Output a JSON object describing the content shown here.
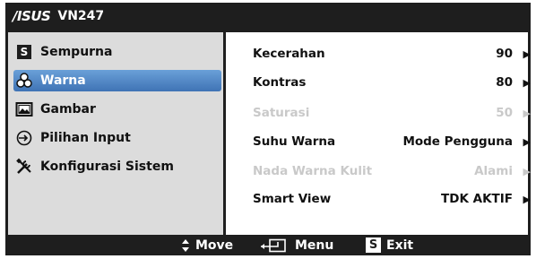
{
  "header": {
    "brand": "/ISUS",
    "model": "VN247"
  },
  "sidebar": {
    "items": [
      {
        "label": "Sempurna",
        "icon": "splendid-s-icon",
        "active": false
      },
      {
        "label": "Warna",
        "icon": "color-palette-icon",
        "active": true
      },
      {
        "label": "Gambar",
        "icon": "image-icon",
        "active": false
      },
      {
        "label": "Pilihan Input",
        "icon": "input-select-icon",
        "active": false
      },
      {
        "label": "Konfigurasi Sistem",
        "icon": "tools-icon",
        "active": false
      }
    ]
  },
  "settings": [
    {
      "label": "Kecerahan",
      "value": "90",
      "enabled": true
    },
    {
      "label": "Kontras",
      "value": "80",
      "enabled": true
    },
    {
      "label": "Saturasi",
      "value": "50",
      "enabled": false
    },
    {
      "label": "Suhu Warna",
      "value": "Mode Pengguna",
      "enabled": true
    },
    {
      "label": "Nada Warna Kulit",
      "value": "Alami",
      "enabled": false
    },
    {
      "label": "Smart View",
      "value": "TDK AKTIF",
      "enabled": true
    }
  ],
  "footer": {
    "move_label": "Move",
    "menu_label": "Menu",
    "exit_label": "Exit",
    "exit_key": "S"
  },
  "colors": {
    "osd_frame": "#1e1e1e",
    "sidebar_bg": "#dcdcdc",
    "active_item": "#4a80c4",
    "disabled_text": "#c9c9c9"
  }
}
